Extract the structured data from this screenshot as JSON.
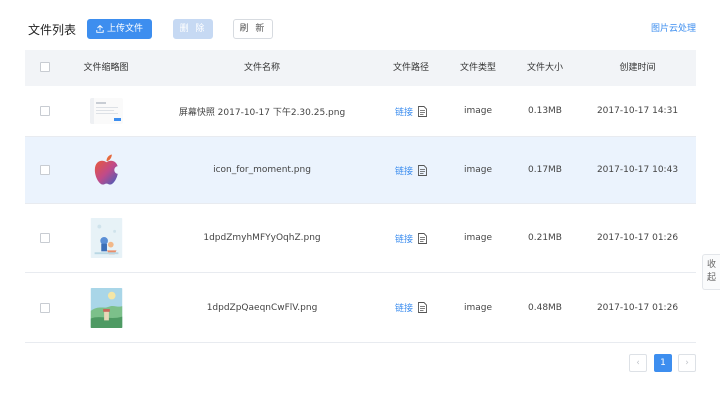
{
  "header": {
    "title": "文件列表",
    "upload_label": "上传文件",
    "delete_label": "删 除",
    "refresh_label": "刷 新",
    "cloud_link": "图片云处理"
  },
  "table": {
    "columns": [
      "文件缩略图",
      "文件名称",
      "文件路径",
      "文件类型",
      "文件大小",
      "创建时间"
    ],
    "rows": [
      {
        "name": "屏幕快照 2017-10-17 下午2.30.25.png",
        "path": "链接",
        "type": "image",
        "size": "0.13MB",
        "created": "2017-10-17 14:31",
        "thumbnail": "screenshot-thumbnail"
      },
      {
        "name": "icon_for_moment.png",
        "path": "链接",
        "type": "image",
        "size": "0.17MB",
        "created": "2017-10-17 10:43",
        "thumbnail": "apple-logo-thumbnail"
      },
      {
        "name": "1dpdZmyhMFYyOqhZ.png",
        "path": "链接",
        "type": "image",
        "size": "0.21MB",
        "created": "2017-10-17 01:26",
        "thumbnail": "illustration-thumbnail"
      },
      {
        "name": "1dpdZpQaeqnCwFlV.png",
        "path": "链接",
        "type": "image",
        "size": "0.48MB",
        "created": "2017-10-17 01:26",
        "thumbnail": "landscape-thumbnail"
      }
    ]
  },
  "pagination": {
    "prev": "‹",
    "current": "1",
    "next": "›"
  },
  "side": {
    "collapse_label": "收起"
  },
  "colors": {
    "accent": "#3d8eef",
    "row_highlight": "#ebf3fd",
    "header_bg": "#f2f4f7"
  }
}
